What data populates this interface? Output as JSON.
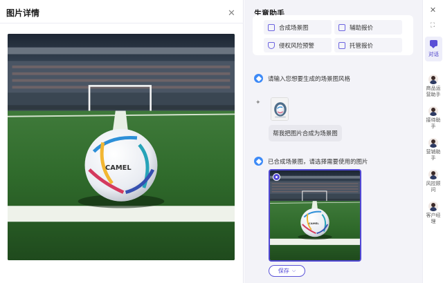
{
  "left_panel": {
    "title": "图片详情"
  },
  "chat": {
    "title": "生意助手",
    "options": [
      {
        "label": "合成场景图",
        "icon": "image-edit-icon"
      },
      {
        "label": "辅助报价",
        "icon": "quote-icon"
      },
      {
        "label": "侵权风险预警",
        "icon": "shield-icon"
      },
      {
        "label": "托管报价",
        "icon": "quote-icon"
      }
    ],
    "bot_prompt": "请输入您想要生成的场景图风格",
    "user_message": "帮我把图片合成为场景图",
    "bot_result": "已合成场景图，请选择需要使用的图片",
    "save_label": "保存"
  },
  "sidebar": {
    "active_tab": "对话",
    "assistants": [
      "商品运营助手",
      "接待助手",
      "营销助手",
      "风控顾问",
      "客户经理"
    ]
  },
  "colors": {
    "accent": "#5147d6",
    "bot_avatar": "#3d8af7",
    "panel_bg": "#f3f3f8"
  }
}
